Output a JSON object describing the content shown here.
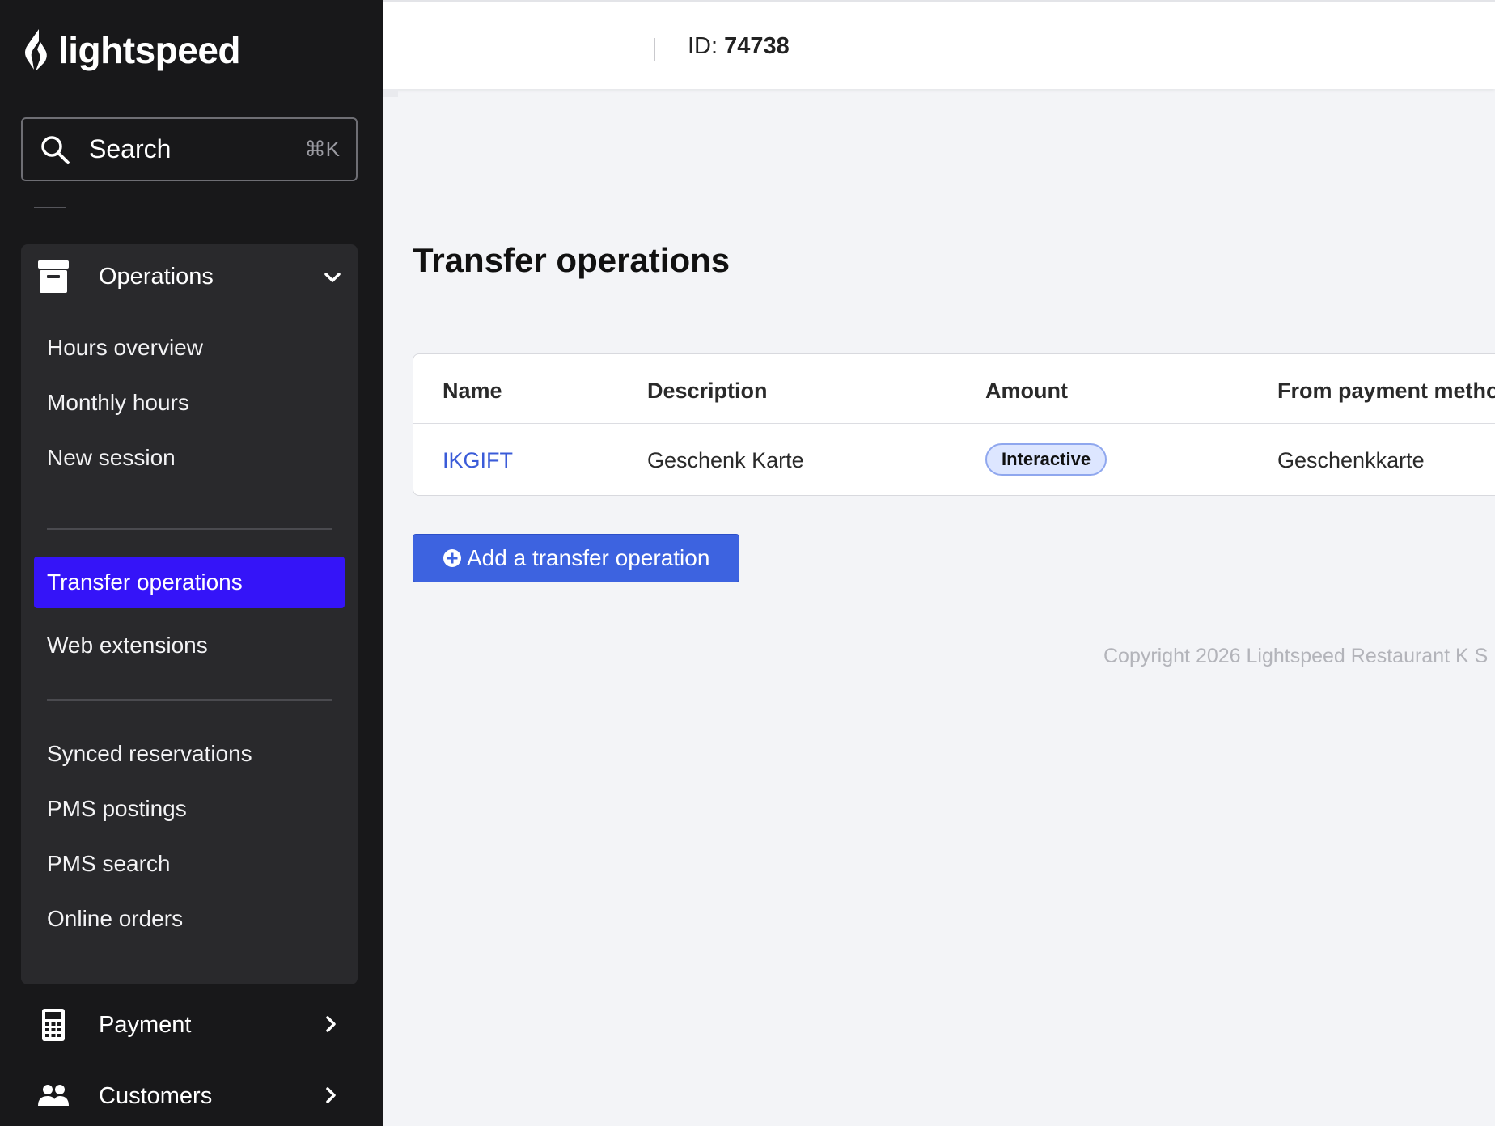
{
  "brand": {
    "name": "lightspeed"
  },
  "search": {
    "label": "Search",
    "shortcut": "⌘K"
  },
  "sidebar": {
    "group": {
      "title": "Operations",
      "expanded": true,
      "items": [
        {
          "label": "Hours overview"
        },
        {
          "label": "Monthly hours"
        },
        {
          "label": "New session"
        },
        {
          "label": "Transfer operations",
          "active": true
        },
        {
          "label": "Web extensions"
        },
        {
          "label": "Synced reservations"
        },
        {
          "label": "PMS postings"
        },
        {
          "label": "PMS search"
        },
        {
          "label": "Online orders"
        }
      ]
    },
    "sections": [
      {
        "label": "Payment",
        "icon": "calculator-icon"
      },
      {
        "label": "Customers",
        "icon": "users-icon"
      }
    ]
  },
  "header": {
    "id_label": "ID:",
    "id_value": "74738"
  },
  "page": {
    "title": "Transfer operations",
    "table": {
      "columns": [
        "Name",
        "Description",
        "Amount",
        "From payment method"
      ],
      "rows": [
        {
          "name": "IKGIFT",
          "description": "Geschenk Karte",
          "amount": "Interactive",
          "from_payment_method": "Geschenkkarte"
        }
      ]
    },
    "add_button": "Add a transfer operation",
    "copyright": "Copyright 2026 Lightspeed Restaurant K S"
  },
  "colors": {
    "sidebar_bg": "#18181a",
    "active_item": "#3514f8",
    "primary_button": "#3d63e0",
    "link": "#3a5bd8"
  }
}
